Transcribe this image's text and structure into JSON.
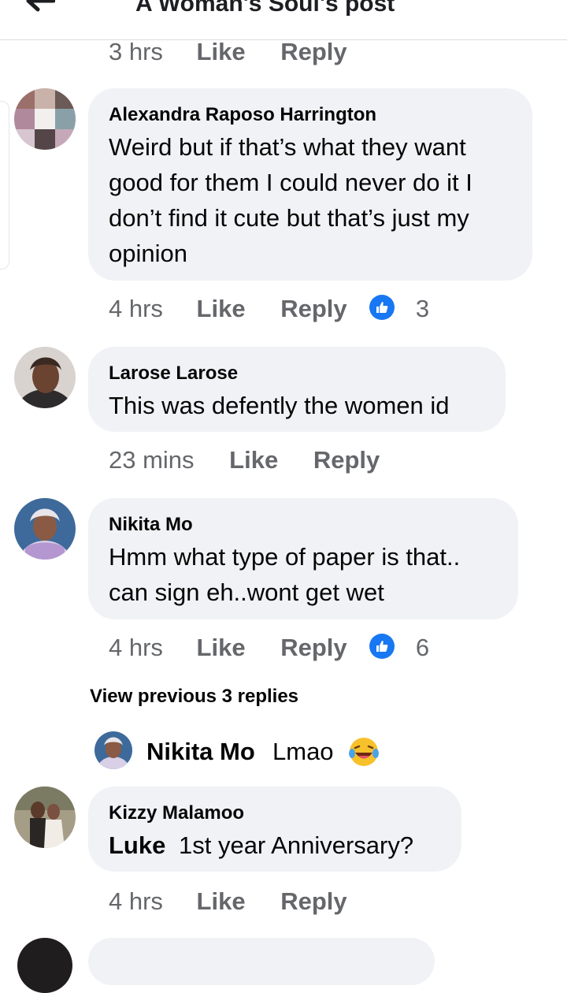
{
  "header": {
    "title": "A Woman's Soul's post",
    "back_icon": "arrow-left-icon"
  },
  "colors": {
    "bubble": "#f0f2f5",
    "meta_text": "#65676b",
    "like_blue": "#1877f2"
  },
  "top_meta": {
    "time": "3 hrs",
    "like": "Like",
    "reply": "Reply"
  },
  "comments": [
    {
      "author": "Alexandra Raposo Harrington",
      "lines": [
        "Weird but if that’s what they want",
        "good for them I could never do it I",
        "don’t find it cute but that’s just my",
        "opinion"
      ],
      "time": "4 hrs",
      "like": "Like",
      "reply": "Reply",
      "reactions": "3",
      "reaction_icon": "thumbs-up-icon"
    },
    {
      "author": "Larose Larose",
      "lines": [
        "This was defently the women id"
      ],
      "time": "23 mins",
      "like": "Like",
      "reply": "Reply"
    },
    {
      "author": "Nikita Mo",
      "lines": [
        "Hmm what type of paper is that..",
        "can sign eh..wont get wet"
      ],
      "time": "4 hrs",
      "like": "Like",
      "reply": "Reply",
      "reactions": "6",
      "reaction_icon": "thumbs-up-icon"
    },
    {
      "author": "Kizzy Malamoo",
      "tag": "Luke",
      "text": "1st year Anniversary?",
      "time": "4 hrs",
      "like": "Like",
      "reply": "Reply"
    }
  ],
  "view_previous": "View previous 3 replies",
  "reply_preview": {
    "author": "Nikita Mo",
    "text": "Lmao",
    "emoji": "laughing-tears-emoji"
  }
}
